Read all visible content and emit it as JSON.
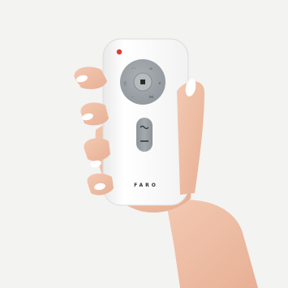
{
  "product": {
    "brand": "FARO",
    "colors": {
      "background": "#f3f3f2",
      "remote_body": "#fbfbfb",
      "dial": "#9ea3a7",
      "skin": "#f0c2aa",
      "nail": "#ffffff",
      "led": "#e23a2f"
    },
    "icons": [
      "power-led",
      "directional-dial",
      "center-stop-button",
      "rocker-button"
    ]
  }
}
